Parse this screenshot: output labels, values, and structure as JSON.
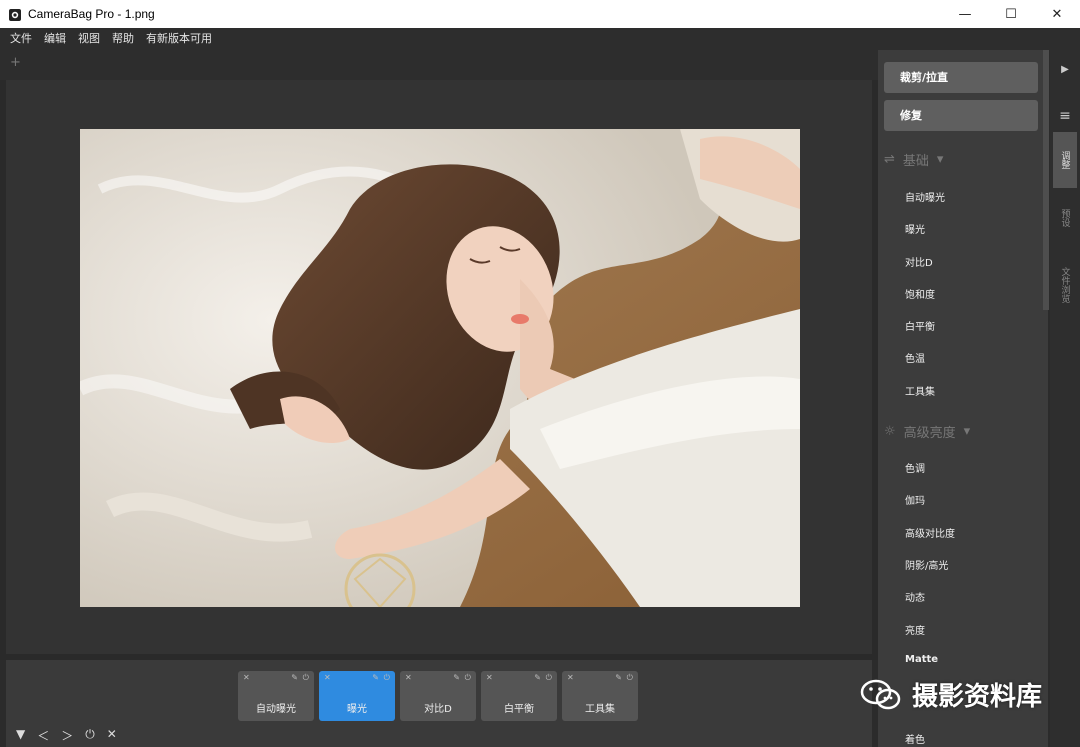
{
  "window": {
    "title": "CameraBag Pro - 1.png",
    "minimize": "—",
    "maximize": "☐",
    "close": "✕"
  },
  "menu": [
    "文件",
    "编辑",
    "视图",
    "帮助",
    "有新版本可用"
  ],
  "canvas": {
    "add_tab": "+"
  },
  "effects_strip": {
    "cards": [
      {
        "label": "自动曝光",
        "active": false
      },
      {
        "label": "曝光",
        "active": true
      },
      {
        "label": "对比D",
        "active": false
      },
      {
        "label": "白平衡",
        "active": false
      },
      {
        "label": "工具集",
        "active": false
      }
    ],
    "card_icons": {
      "remove": "✕",
      "pin": "✎",
      "power": "⏻"
    },
    "controls": [
      "▼",
      "＜",
      "＞",
      "⏻",
      "✕"
    ]
  },
  "right_panel": {
    "crop_button": "裁剪/拉直",
    "repair_button": "修复",
    "basic_section": "基础",
    "basic_items": [
      "自动曝光",
      "曝光",
      "对比D",
      "饱和度",
      "白平衡",
      "色温",
      "工具集"
    ],
    "advanced_section": "高级亮度",
    "advanced_items": [
      "色调",
      "伽玛",
      "高级对比度",
      "阴影/高光",
      "动态",
      "亮度",
      "Matte",
      "着色"
    ]
  },
  "side_tabs": {
    "play": "▶",
    "menu": "≡",
    "tabs": [
      "调整",
      "预设",
      "文件浏览"
    ]
  },
  "watermark": {
    "text": "摄影资料库"
  },
  "colors": {
    "accent": "#2f8be0",
    "panel": "#3c3c3c",
    "background": "#2b2b2b"
  }
}
